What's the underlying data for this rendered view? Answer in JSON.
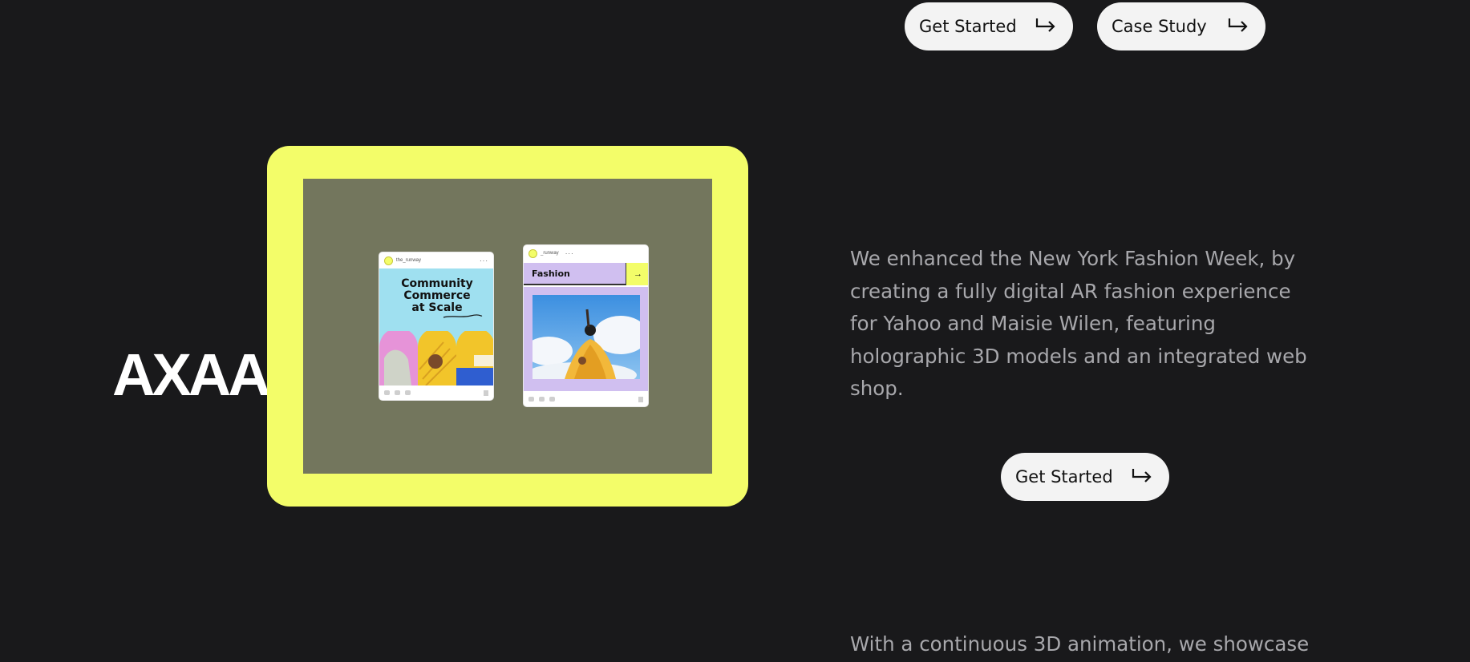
{
  "header": {
    "get_started_label": "Get Started",
    "case_study_label": "Case Study"
  },
  "brand": {
    "logo_text": "AXAA",
    "accent_color": "#f3fd69"
  },
  "showcase": {
    "card1": {
      "username": "the_runway",
      "title_line1": "Community",
      "title_line2": "Commerce",
      "title_line3": "at Scale"
    },
    "card2": {
      "username": "_runway",
      "label": "Fashion",
      "go_arrow": "→"
    }
  },
  "main": {
    "description": "We enhanced the New York Fashion Week, by creating a fully digital AR fashion experience for Yahoo and Maisie Wilen, featuring holographic 3D models and an integrated web shop.",
    "cta_label": "Get Started",
    "next_paragraph": "With a continuous 3D animation, we showcase"
  },
  "icons": {
    "pill_arrow": "return-arrow-icon"
  }
}
